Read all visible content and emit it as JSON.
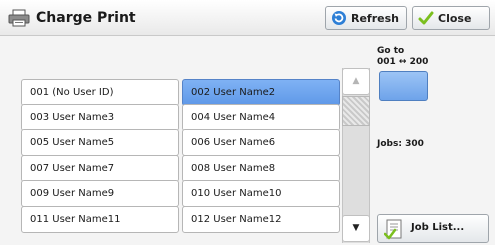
{
  "header": {
    "title": "Charge Print",
    "title_icon": "printer-icon",
    "refresh_label": "Refresh",
    "refresh_icon": "refresh-icon",
    "close_label": "Close",
    "close_icon": "checkmark-icon"
  },
  "users": [
    {
      "label": "001  (No User ID)",
      "selected": false
    },
    {
      "label": "002  User Name2",
      "selected": true
    },
    {
      "label": "003  User Name3",
      "selected": false
    },
    {
      "label": "004  User Name4",
      "selected": false
    },
    {
      "label": "005  User Name5",
      "selected": false
    },
    {
      "label": "006  User Name6",
      "selected": false
    },
    {
      "label": "007  User Name7",
      "selected": false
    },
    {
      "label": "008  User Name8",
      "selected": false
    },
    {
      "label": "009  User Name9",
      "selected": false
    },
    {
      "label": "010  User Name10",
      "selected": false
    },
    {
      "label": "011  User Name11",
      "selected": false
    },
    {
      "label": "012  User Name12",
      "selected": false
    }
  ],
  "scroll": {
    "up": "▲",
    "down": "▼"
  },
  "goto": {
    "label": "Go to",
    "range": "001 ↔ 200"
  },
  "jobs_label": "Jobs: 300",
  "joblist_label": "Job List...",
  "joblist_icon": "job-list-icon",
  "colors": {
    "selected": "#6aa2ed",
    "accent": "#4f7fc0"
  }
}
